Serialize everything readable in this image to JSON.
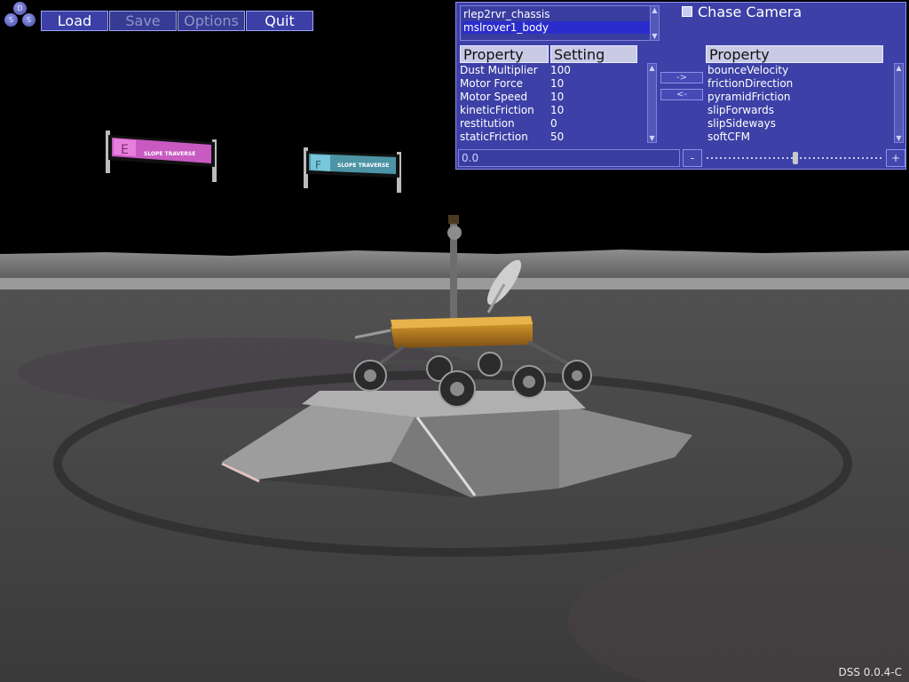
{
  "app": {
    "logo_letters": [
      "D",
      "S",
      "S"
    ],
    "version": "DSS 0.0.4-C"
  },
  "menu": {
    "load": "Load",
    "save": "Save",
    "options": "Options",
    "quit": "Quit"
  },
  "panel": {
    "objects": [
      "rlep2rvr_chassis",
      "mslrover1_body"
    ],
    "selected_object": "mslrover1_body",
    "chase_camera": {
      "label": "Chase Camera",
      "checked": false
    },
    "property_header": "Property",
    "setting_header": "Setting",
    "properties": [
      {
        "name": "Dust Multiplier",
        "value": "100"
      },
      {
        "name": "Motor Force",
        "value": "10"
      },
      {
        "name": "Motor Speed",
        "value": "10"
      },
      {
        "name": "kineticFriction",
        "value": "10"
      },
      {
        "name": "restitution",
        "value": "0"
      },
      {
        "name": "staticFriction",
        "value": "50"
      }
    ],
    "available_header": "Property",
    "available_properties": [
      "bounceVelocity",
      "frictionDirection",
      "pyramidFriction",
      "slipForwards",
      "slipSideways",
      "softCFM"
    ],
    "add_button": "->",
    "remove_button": "<-",
    "value_field": "0.0",
    "decrement": "-",
    "increment": "+",
    "slider_level": 0.5
  },
  "scene": {
    "sign_left_letter": "E",
    "sign_left_text": "SLOPE TRAVERSE",
    "sign_right_letter": "F",
    "sign_right_text": "SLOPE TRAVERSE"
  }
}
